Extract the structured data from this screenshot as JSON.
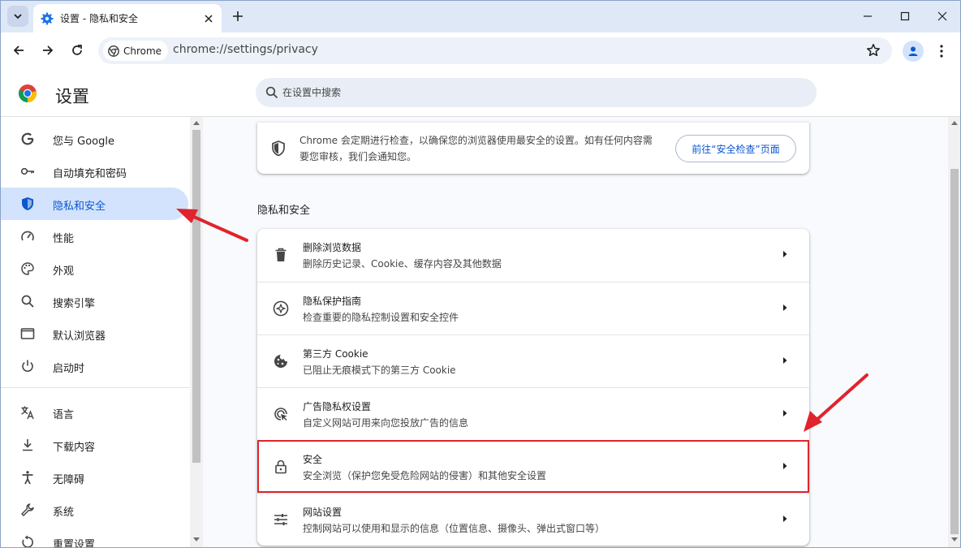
{
  "browser": {
    "tab_title": "设置 - 隐私和安全",
    "site_chip": "Chrome",
    "url": "chrome://settings/privacy"
  },
  "header": {
    "title": "设置",
    "search_placeholder": "在设置中搜索"
  },
  "sidebar": {
    "items": [
      {
        "label": "您与 Google",
        "icon": "google-g-icon"
      },
      {
        "label": "自动填充和密码",
        "icon": "key-icon"
      },
      {
        "label": "隐私和安全",
        "icon": "shield-icon",
        "active": true
      },
      {
        "label": "性能",
        "icon": "speedometer-icon"
      },
      {
        "label": "外观",
        "icon": "palette-icon"
      },
      {
        "label": "搜索引擎",
        "icon": "search-icon"
      },
      {
        "label": "默认浏览器",
        "icon": "browser-window-icon"
      },
      {
        "label": "启动时",
        "icon": "power-icon"
      },
      {
        "label": "语言",
        "icon": "translate-icon"
      },
      {
        "label": "下载内容",
        "icon": "download-icon"
      },
      {
        "label": "无障碍",
        "icon": "accessibility-icon"
      },
      {
        "label": "系统",
        "icon": "wrench-icon"
      },
      {
        "label": "重置设置",
        "icon": "reset-icon"
      }
    ]
  },
  "safety_check": {
    "text": "Chrome 会定期进行检查，以确保您的浏览器使用最安全的设置。如有任何内容需要您审核，我们会通知您。",
    "button": "前往“安全检查”页面"
  },
  "privacy_section": {
    "title": "隐私和安全",
    "rows": [
      {
        "title": "删除浏览数据",
        "subtitle": "删除历史记录、Cookie、缓存内容及其他数据",
        "icon": "trash-icon"
      },
      {
        "title": "隐私保护指南",
        "subtitle": "检查重要的隐私控制设置和安全控件",
        "icon": "compass-icon"
      },
      {
        "title": "第三方 Cookie",
        "subtitle": "已阻止无痕模式下的第三方 Cookie",
        "icon": "cookie-icon"
      },
      {
        "title": "广告隐私权设置",
        "subtitle": "自定义网站可用来向您投放广告的信息",
        "icon": "ad-privacy-icon"
      },
      {
        "title": "安全",
        "subtitle": "安全浏览（保护您免受危险网站的侵害）和其他安全设置",
        "icon": "lock-icon",
        "highlighted": true
      },
      {
        "title": "网站设置",
        "subtitle": "控制网站可以使用和显示的信息（位置信息、摄像头、弹出式窗口等）",
        "icon": "sliders-icon"
      }
    ]
  },
  "colors": {
    "accent": "#0b57d0",
    "active_nav_bg": "#d3e3fd",
    "annotation": "#e0232c",
    "tabstrip": "#dfe8f7"
  }
}
